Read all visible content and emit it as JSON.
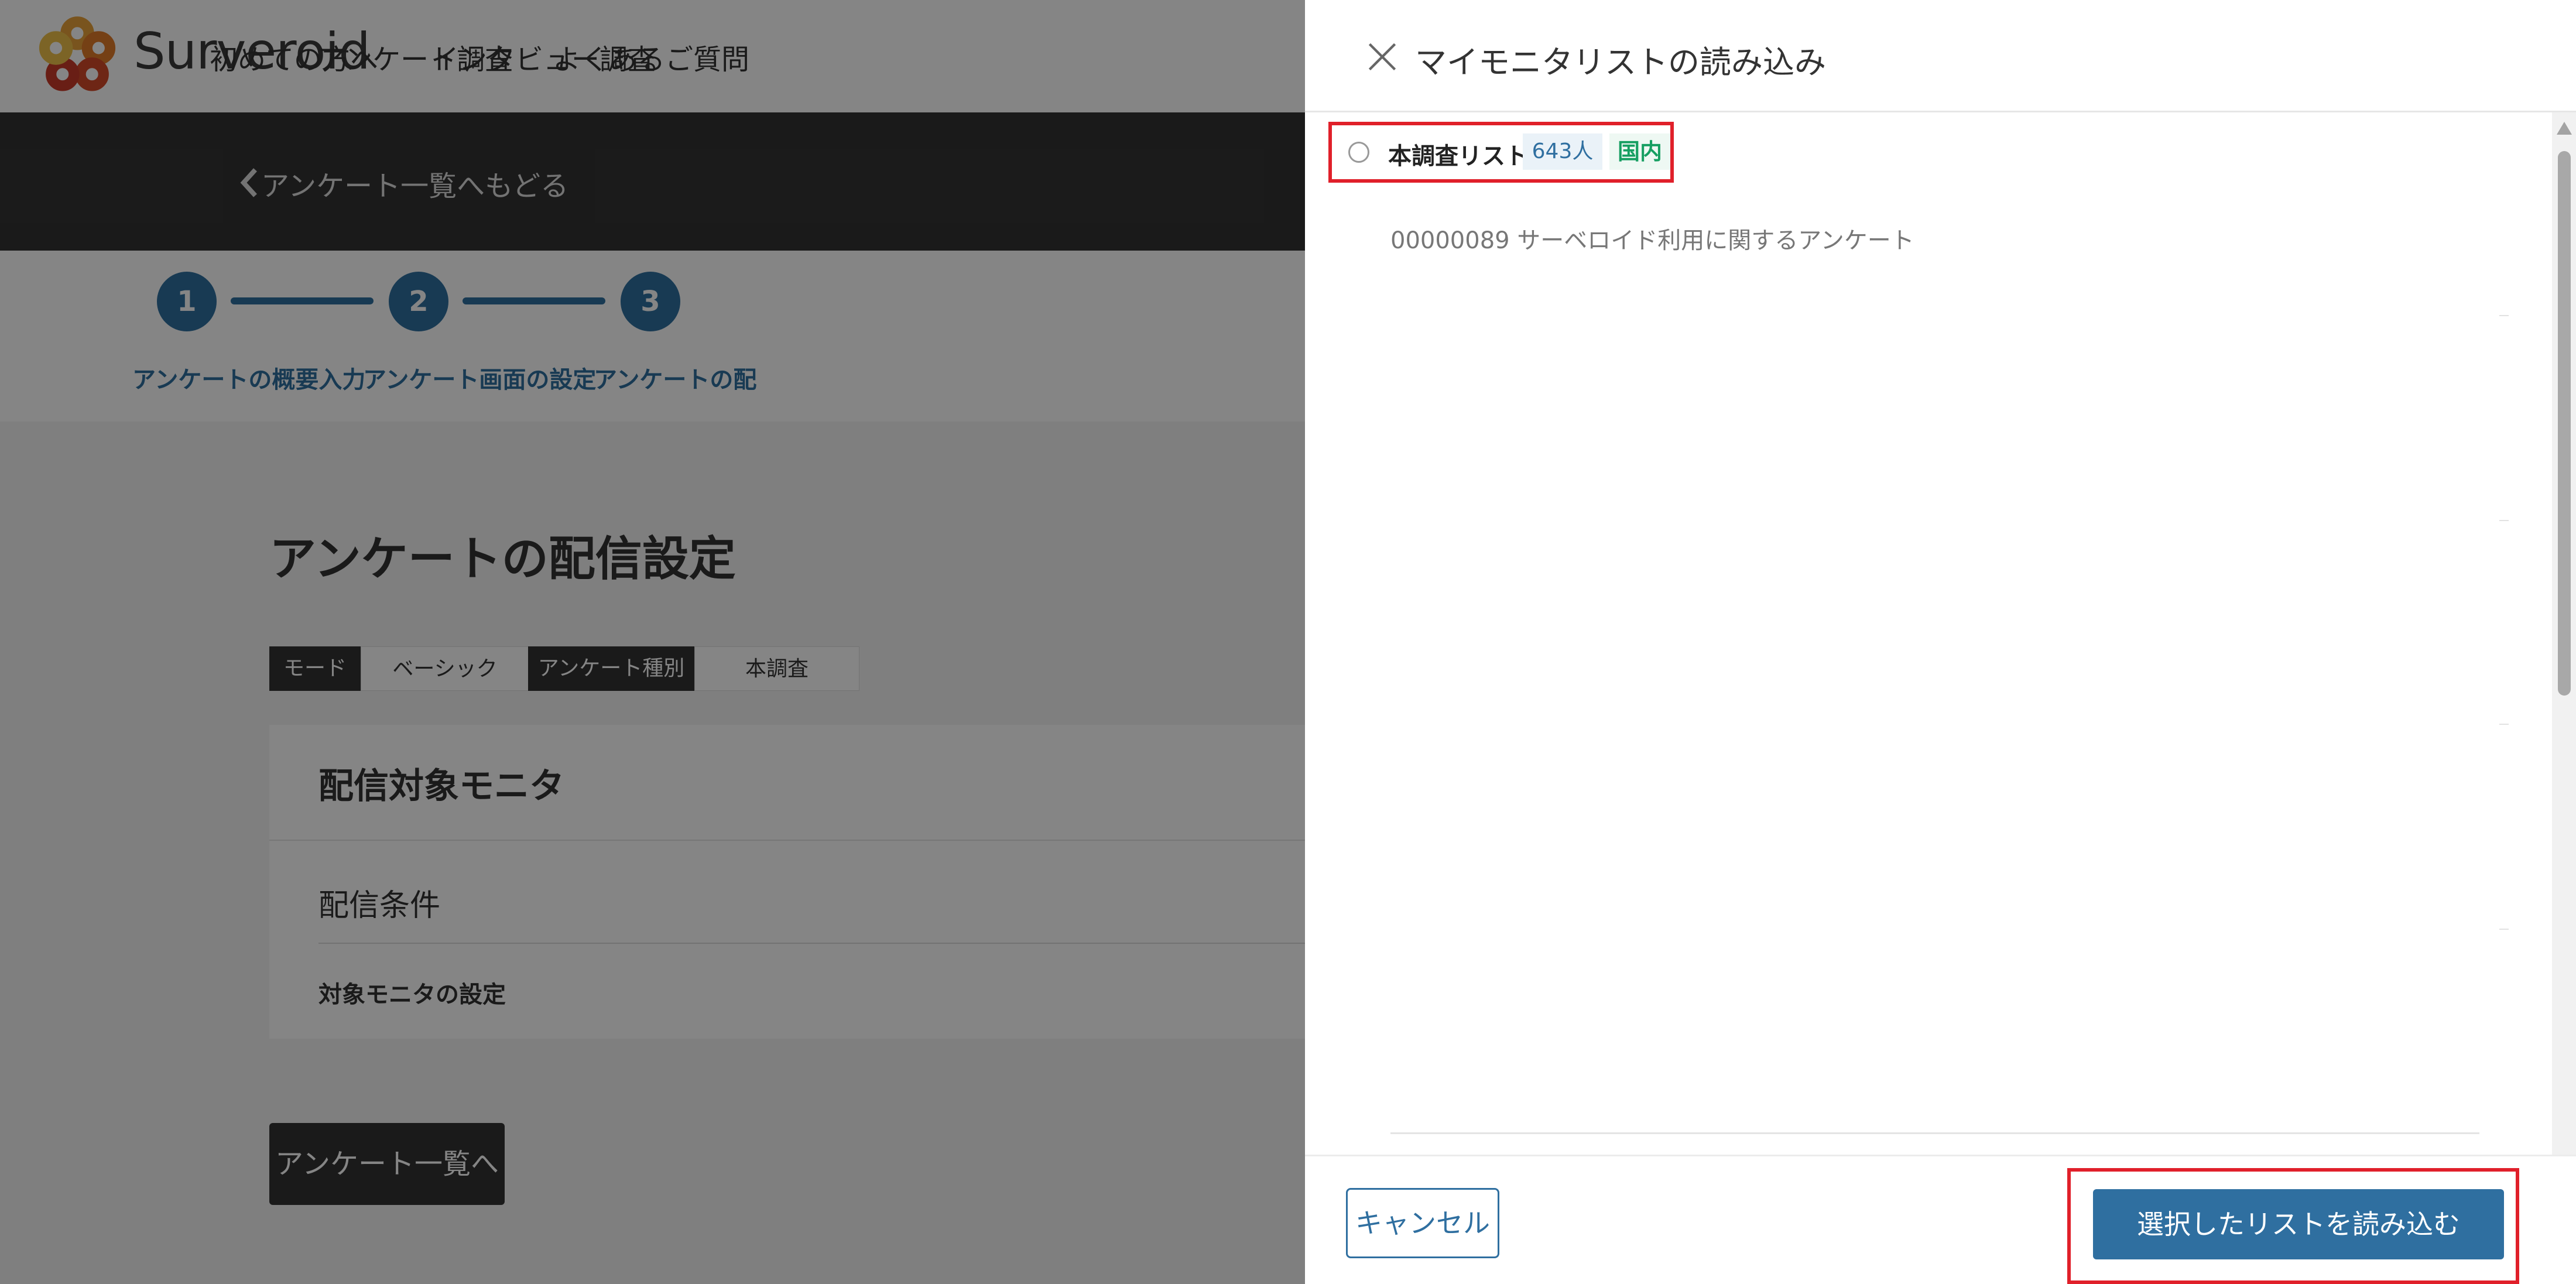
{
  "header": {
    "brand": "Surveroid",
    "nav": [
      "初めての方へ",
      "アンケート調査",
      "インタビュー調査",
      "よくあるご質問"
    ]
  },
  "back_link": "アンケート一覧へもどる",
  "steps": [
    {
      "number": "1",
      "label": "アンケートの概要入力"
    },
    {
      "number": "2",
      "label": "アンケート画面の設定"
    },
    {
      "number": "3",
      "label": "アンケートの配"
    }
  ],
  "main": {
    "title": "アンケートの配信設定",
    "tags": [
      {
        "label": "モード",
        "style": "dark"
      },
      {
        "label": "ベーシック",
        "style": "light"
      },
      {
        "label": "アンケート種別",
        "style": "dark"
      },
      {
        "label": "本調査",
        "style": "light"
      }
    ],
    "card": {
      "title": "配信対象モニタ",
      "condition": "配信条件",
      "monitor_setting": "対象モニタの設定"
    },
    "back_button": "アンケート一覧へ"
  },
  "modal": {
    "title": "マイモニタリストの読み込み",
    "list_item": {
      "name": "本調査リスト",
      "count": "643人",
      "region": "国内",
      "selected": false
    },
    "description": "00000089 サーベロイド利用に関するアンケート",
    "cancel_label": "キャンセル",
    "submit_label": "選択したリストを読み込む"
  },
  "colors": {
    "primary": "#2f6fa0",
    "header_dark": "#333333",
    "highlight": "#e0202a",
    "region_green": "#169f62"
  }
}
